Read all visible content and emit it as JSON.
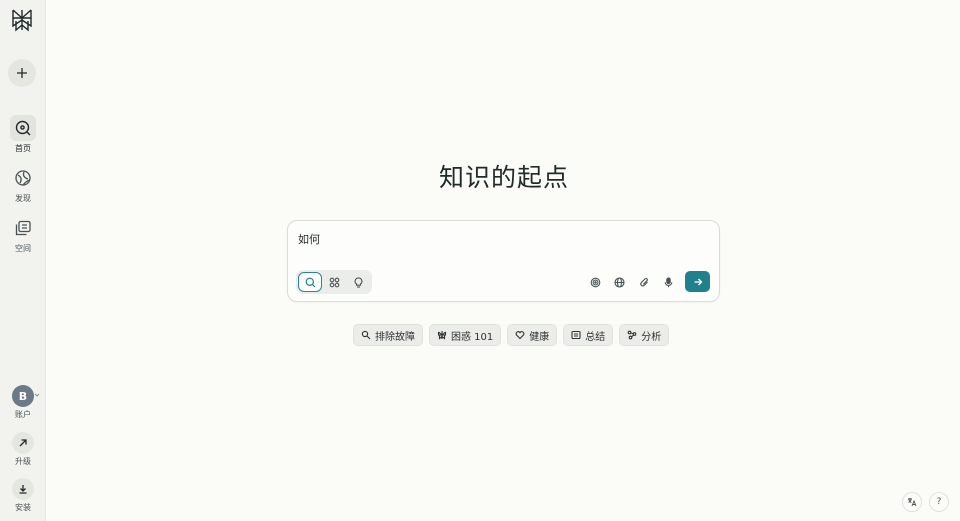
{
  "sidebar": {
    "logo_icon": "perplexity-logo-icon",
    "new_thread_icon": "plus-icon",
    "nav": [
      {
        "label": "首页",
        "icon": "search-circle-icon",
        "active": true
      },
      {
        "label": "发现",
        "icon": "globe-icon",
        "active": false
      },
      {
        "label": "空间",
        "icon": "spaces-icon",
        "active": false
      }
    ],
    "account": {
      "avatar_letter": "B",
      "label": "账户"
    },
    "upgrade": {
      "label": "升级"
    },
    "install": {
      "label": "安装"
    }
  },
  "main": {
    "headline": "知识的起点",
    "composer": {
      "query_text": "如何",
      "modes": [
        "search-icon",
        "research-icon",
        "bulb-icon"
      ],
      "active_mode": 0,
      "tools": [
        "focus-icon",
        "globe-icon",
        "paperclip-icon",
        "microphone-icon"
      ],
      "submit_icon": "arrow-right-icon"
    },
    "chips": [
      {
        "label": "排除故障",
        "icon": "wrench-icon"
      },
      {
        "label": "困惑 101",
        "icon": "brain-icon"
      },
      {
        "label": "健康",
        "icon": "heart-icon"
      },
      {
        "label": "总结",
        "icon": "list-icon"
      },
      {
        "label": "分析",
        "icon": "analysis-icon"
      }
    ]
  },
  "corner": {
    "language_icon": "translate-icon",
    "help_label": "?"
  },
  "colors": {
    "accent": "#21808d",
    "background": "#fbfbf7",
    "sidebar": "#f2f2ee"
  }
}
